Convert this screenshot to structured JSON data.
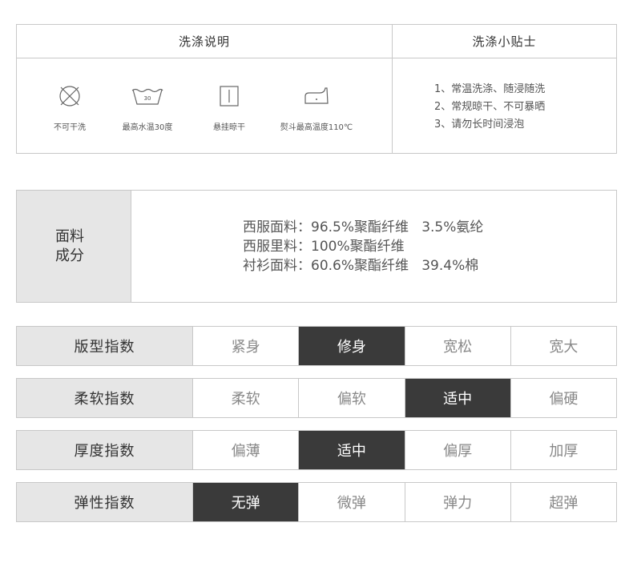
{
  "care": {
    "title_left": "洗涤说明",
    "title_right": "洗涤小贴士",
    "icons": [
      {
        "icon": "no-wash-icon",
        "label": "不可干洗"
      },
      {
        "icon": "wash-30-icon",
        "label": "最高水温30度",
        "badge": "30"
      },
      {
        "icon": "hang-dry-icon",
        "label": "悬挂晾干"
      },
      {
        "icon": "iron-icon",
        "label": "熨斗最高温度110℃"
      }
    ],
    "tips": [
      "1、常温洗涤、随浸随洗",
      "2、常规晾干、不可暴晒",
      "3、请勿长时间浸泡"
    ]
  },
  "fabric": {
    "label_line1": "面料",
    "label_line2": "成分",
    "lines": [
      "西服面料：96.5%聚酯纤维   3.5%氨纶",
      "西服里料：100%聚酯纤维",
      "衬衫面料：60.6%聚酯纤维   39.4%棉"
    ]
  },
  "indices": [
    {
      "label": "版型指数",
      "options": [
        "紧身",
        "修身",
        "宽松",
        "宽大"
      ],
      "selected": "修身"
    },
    {
      "label": "柔软指数",
      "options": [
        "柔软",
        "偏软",
        "适中",
        "偏硬"
      ],
      "selected": "适中"
    },
    {
      "label": "厚度指数",
      "options": [
        "偏薄",
        "适中",
        "偏厚",
        "加厚"
      ],
      "selected": "适中"
    },
    {
      "label": "弹性指数",
      "options": [
        "无弹",
        "微弹",
        "弹力",
        "超弹"
      ],
      "selected": "无弹"
    }
  ],
  "colors": {
    "active_bg": "#3a3a3a",
    "label_bg": "#e6e6e6",
    "border": "#c8c8c8"
  }
}
